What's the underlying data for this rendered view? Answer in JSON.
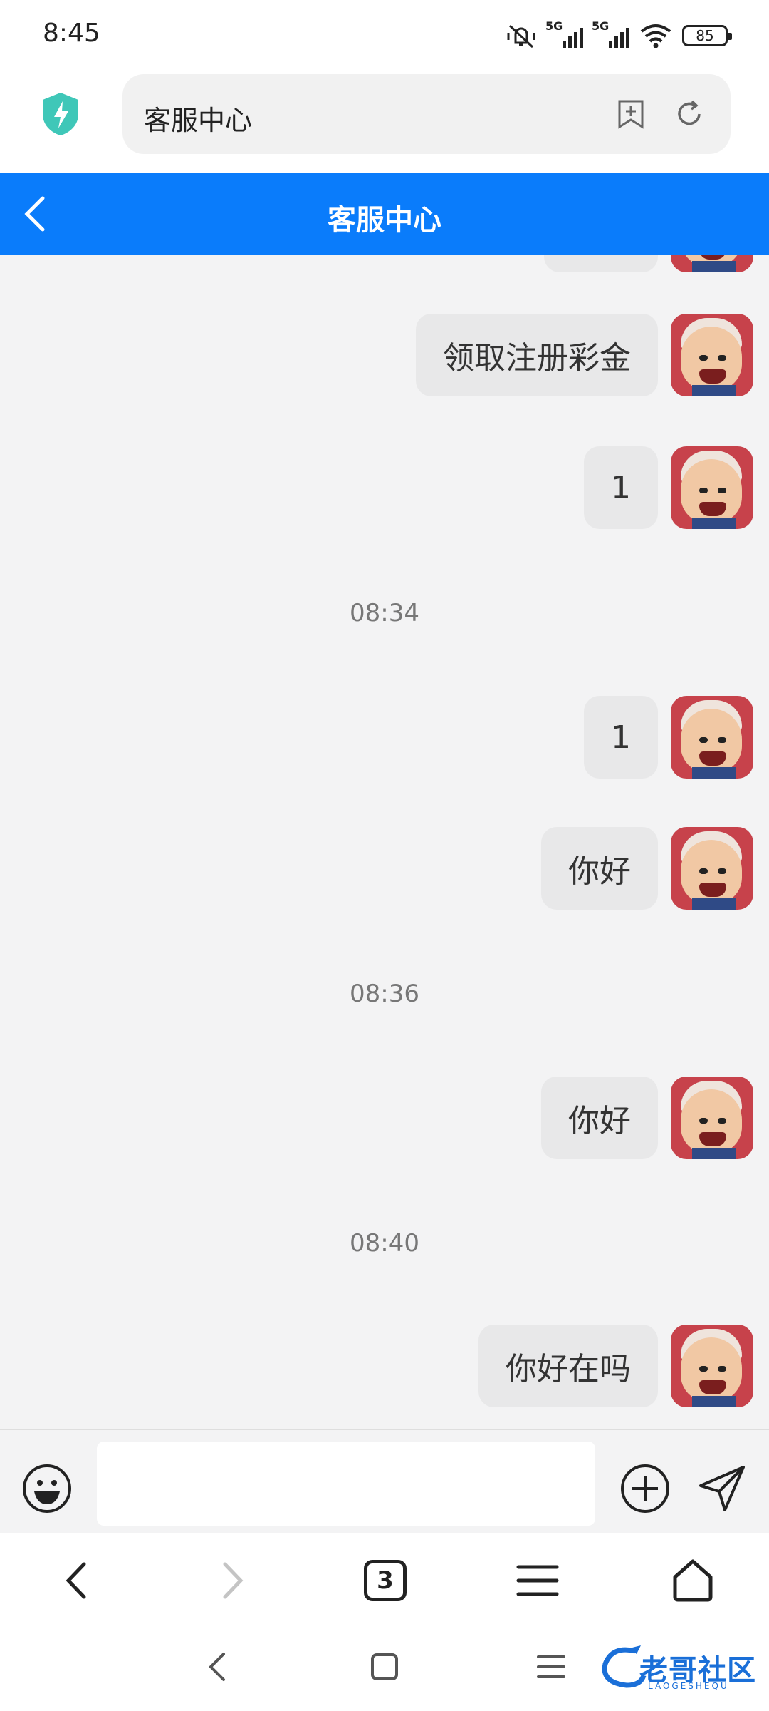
{
  "status_bar": {
    "time": "8:45",
    "signal_labels": [
      "5G",
      "5G"
    ],
    "battery": "85"
  },
  "browser": {
    "url_title": "客服中心"
  },
  "header": {
    "title": "客服中心"
  },
  "messages": [
    {
      "text": "领取注册彩金"
    },
    {
      "text": "1"
    },
    {
      "timestamp": "08:34"
    },
    {
      "text": "1"
    },
    {
      "text": "你好"
    },
    {
      "timestamp": "08:36"
    },
    {
      "text": "你好"
    },
    {
      "timestamp": "08:40"
    },
    {
      "text": "你好在吗"
    }
  ],
  "input": {
    "value": "",
    "placeholder": ""
  },
  "nav": {
    "tabs_count": "3"
  },
  "watermark": {
    "text": "老哥社区",
    "sub": "LAOGESHEQU"
  },
  "colors": {
    "header": "#0a7cfb",
    "chat_bg": "#f3f3f4",
    "bubble": "#e8e8e9",
    "shield": "#3fc7b8"
  }
}
